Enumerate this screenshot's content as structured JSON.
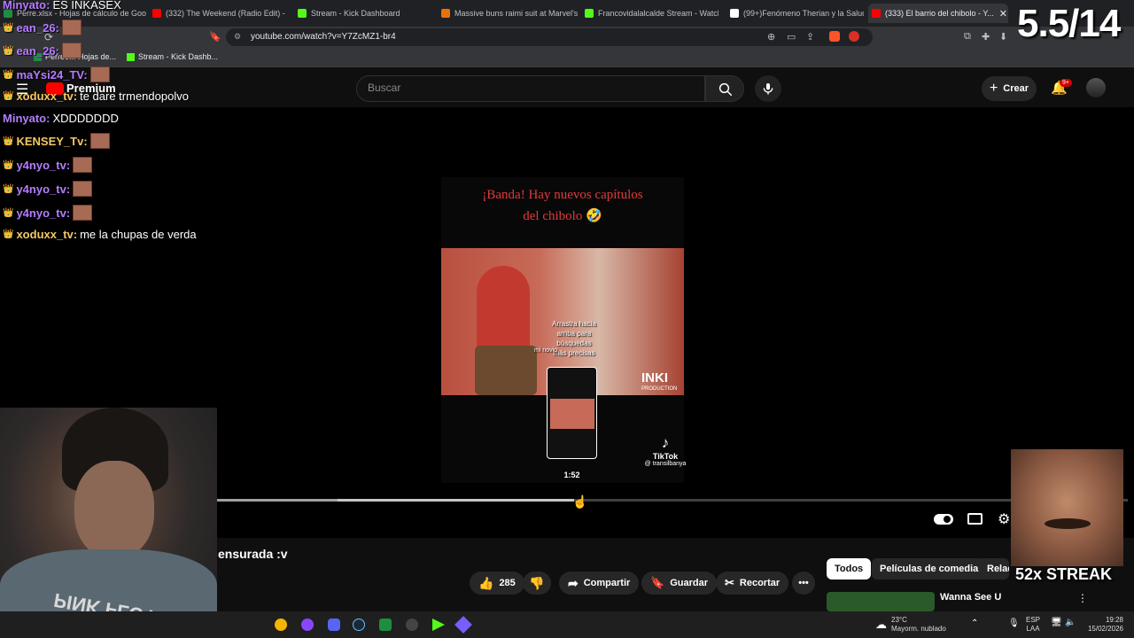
{
  "browser": {
    "tabs": [
      {
        "label": "Perre.xlsx - Hojas de cálculo de Goo...",
        "color": "#1e8e3e"
      },
      {
        "label": "(332) The Weekend (Radio Edit) - Yo...",
        "color": "#ff0000"
      },
      {
        "label": "Stream - Kick Dashboard",
        "color": "#53fc18"
      },
      {
        "label": "Massive buns raimi suit at Marvel's S...",
        "color": "#e8710a"
      },
      {
        "label": "Francovidalalcalde Stream - Watch L...",
        "color": "#53fc18"
      },
      {
        "label": "(99+)Fenómeno Therian y la Salud M...",
        "color": "#ffffff"
      },
      {
        "label": "(333) El barrio del chibolo - Y...",
        "color": "#ff0000"
      }
    ],
    "url": "youtube.com/watch?v=Y7ZcMZ1-br4",
    "bookmarks": [
      {
        "label": "Perreo... Hojas de..."
      },
      {
        "label": "Stream - Kick Dashb..."
      }
    ]
  },
  "youtube": {
    "logo_label": "Premium",
    "search_placeholder": "Buscar",
    "create_label": "Crear",
    "notif_count": "9+",
    "short_title_line1": "¡Banda! Hay nuevos capítulos",
    "short_title_line2": "del chibolo 🤣",
    "short_overlay_text": "Arrastra hacia arriba para búsquedas más precisas",
    "short_overlay_small": "mi novio",
    "short_brand": "INKI",
    "short_brand_sub": "PRODUCTION",
    "tiktok_label": "TikTok",
    "tiktok_user": "@ transilbanya",
    "preview_time": "1:52",
    "progress": {
      "played": 0.055,
      "buffered": 0.295,
      "hover": 0.506
    },
    "video_title_fragment": "ensurada :v",
    "actions": {
      "likes": "285",
      "share": "Compartir",
      "save": "Guardar",
      "clip": "Recortar"
    },
    "chips": [
      "Todos",
      "Películas de comedia",
      "Relacionados"
    ],
    "rec_title": "Wanna See U"
  },
  "stream": {
    "counter": "5.5/14",
    "streak": "52x STREAK",
    "chat": [
      {
        "user": "Minyato:",
        "msg": "ES INKASEX",
        "style": "violet",
        "badges": ""
      },
      {
        "user": "ean_26:",
        "msg": "",
        "style": "violet",
        "badges": "👑"
      },
      {
        "user": "ean_26:",
        "msg": "",
        "style": "violet",
        "badges": "👑"
      },
      {
        "user": "maYsi24_TV:",
        "msg": "",
        "style": "violet",
        "badges": "👑"
      },
      {
        "user": "xoduxx_tv:",
        "msg": "te dare trmendopolvo",
        "style": "gold",
        "badges": "👑"
      },
      {
        "user": "Minyato:",
        "msg": "XDDDDDDD",
        "style": "violet",
        "badges": ""
      },
      {
        "user": "KENSEY_Tv:",
        "msg": "",
        "style": "gold",
        "badges": "👑"
      },
      {
        "user": "y4nyo_tv:",
        "msg": "",
        "style": "violet",
        "badges": "👑"
      },
      {
        "user": "y4nyo_tv:",
        "msg": "",
        "style": "violet",
        "badges": "👑"
      },
      {
        "user": "y4nyo_tv:",
        "msg": "",
        "style": "violet",
        "badges": "👑"
      },
      {
        "user": "xoduxx_tv:",
        "msg": "me la chupas de verda",
        "style": "gold",
        "badges": "👑"
      }
    ],
    "webcam_shirt_text": "PINK FLOYD"
  },
  "taskbar": {
    "weather_temp": "23°C",
    "weather_desc": "Mayorm. nublado",
    "lang_top": "ESP",
    "lang_bottom": "LAA",
    "time": "19:28",
    "date": "15/02/2026"
  }
}
